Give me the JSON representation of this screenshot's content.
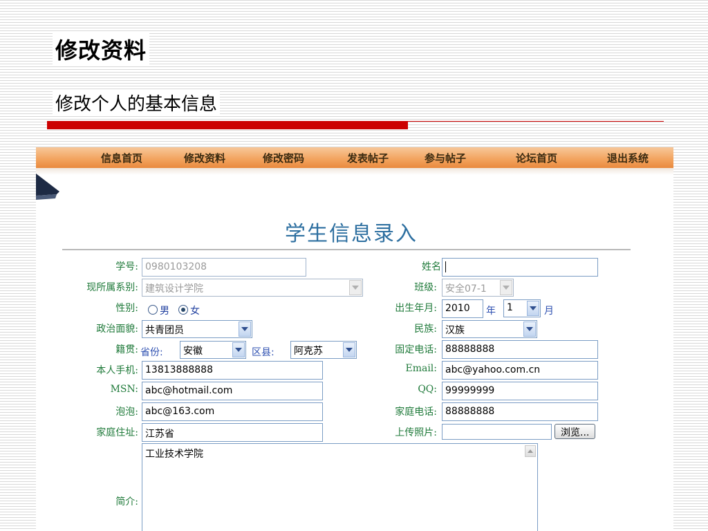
{
  "slide": {
    "title": "修改资料",
    "subtitle": "修改个人的基本信息"
  },
  "nav": {
    "items": [
      "信息首页",
      "修改资料",
      "修改密码",
      "发表帖子",
      "参与帖子",
      "论坛首页",
      "退出系统"
    ]
  },
  "form": {
    "title": "学生信息录入",
    "labels": {
      "student_id": "学号:",
      "name": "姓名",
      "department": "现所属系别:",
      "class": "班级:",
      "gender": "性别:",
      "birth": "出生年月:",
      "political": "政治面貌:",
      "ethnicity": "民族:",
      "native_place": "籍贯:",
      "landline": "固定电话:",
      "mobile": "本人手机:",
      "email": "Email:",
      "msn": "MSN:",
      "qq": "QQ:",
      "paopao": "泡泡:",
      "home_phone": "家庭电话:",
      "address": "家庭住址:",
      "photo": "上传照片:",
      "intro": "简介:"
    },
    "values": {
      "student_id": "0980103208",
      "name": "",
      "department": "建筑设计学院",
      "class": "安全07-1",
      "gender_male": "男",
      "gender_female": "女",
      "gender_selected": "女",
      "birth_year": "2010",
      "birth_year_unit": "年",
      "birth_month": "1",
      "birth_month_unit": "月",
      "political": "共青团员",
      "ethnicity": "汉族",
      "province_label": "省份:",
      "province": "安徽",
      "county_label": "区县:",
      "county": "阿克苏",
      "landline": "88888888",
      "mobile": "13813888888",
      "email": "abc@yahoo.com.cn",
      "msn": "abc@hotmail.com",
      "qq": "99999999",
      "paopao": "abc@163.com",
      "home_phone": "88888888",
      "address": "江苏省",
      "photo": "",
      "browse_label": "浏览...",
      "intro": "工业技术学院"
    }
  },
  "colors": {
    "title_blue": "#2d6fa0",
    "label_green": "#1f7a3a",
    "nav_orange": "#f2a25c",
    "red_bar": "#cc0000"
  }
}
